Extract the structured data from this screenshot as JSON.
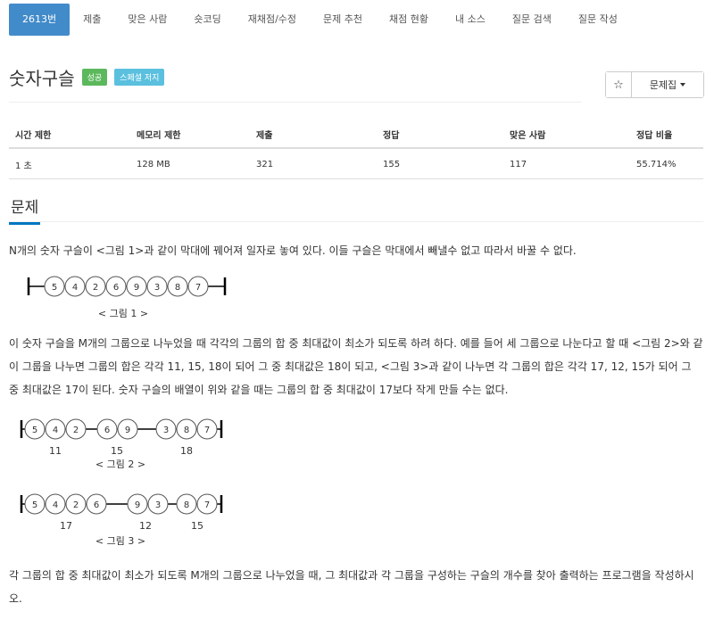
{
  "nav": {
    "items": [
      "2613번",
      "제출",
      "맞은 사람",
      "숏코딩",
      "재채점/수정",
      "문제 추천",
      "채점 현황",
      "내 소스",
      "질문 검색",
      "질문 작성"
    ]
  },
  "problem": {
    "title": "숫자구슬",
    "badges": [
      "성공",
      "스페셜 저지"
    ],
    "star_icon": "star-icon",
    "problemset_label": "문제집"
  },
  "info_table": {
    "headers": [
      "시간 제한",
      "메모리 제한",
      "제출",
      "정답",
      "맞은 사람",
      "정답 비율"
    ],
    "values": [
      "1 초",
      "128 MB",
      "321",
      "155",
      "117",
      "55.714%"
    ]
  },
  "section": {
    "title": "문제"
  },
  "description": {
    "p1": "N개의 숫자 구슬이 <그림 1>과 같이 막대에 꿰어져 일자로 놓여 있다. 이들 구슬은 막대에서 빼낼수 없고 따라서 바꿀 수 없다.",
    "p2": "이 숫자 구슬을 M개의 그룹으로 나누었을 때 각각의 그룹의 합 중 최대값이 최소가 되도록 하려 하다. 예를 들어 세 그룹으로 나눈다고 할 때 <그림 2>와 같이 그룹을 나누면 그룹의 합은 각각 11, 15, 18이 되어 그 중 최대값은 18이 되고, <그림 3>과 같이 나누면 각 그룹의 합은 각각 17, 12, 15가 되어 그 중 최대값은 17이 된다. 숫자 구슬의 배열이 위와 같을 때는 그룹의 합 중 최대값이 17보다 작게 만들 수는 없다.",
    "p3": "각 그룹의 합 중 최대값이 최소가 되도록 M개의 그룹으로 나누었을 때, 그 최대값과 각 그룹을 구성하는 구슬의 개수를 찾아 출력하는 프로그램을 작성하시오."
  },
  "figures": {
    "beads": [
      "5",
      "4",
      "2",
      "6",
      "9",
      "3",
      "8",
      "7"
    ],
    "fig1": {
      "caption": "< 그림  1 >"
    },
    "fig2": {
      "caption": "< 그림  2 >",
      "sums": [
        "11",
        "15",
        "18"
      ]
    },
    "fig3": {
      "caption": "< 그림  3 >",
      "sums": [
        "17",
        "12",
        "15"
      ]
    }
  }
}
